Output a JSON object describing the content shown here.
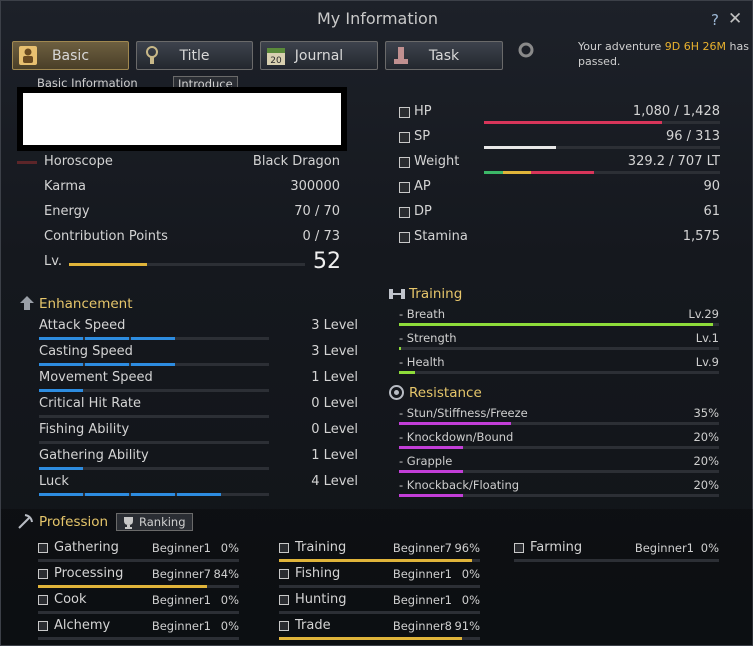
{
  "window": {
    "title": "My Information",
    "help_label": "?",
    "close_label": "✕"
  },
  "tabs": [
    {
      "label": "Basic",
      "icon": "person-icon",
      "active": true
    },
    {
      "label": "Title",
      "icon": "medal-icon",
      "active": false
    },
    {
      "label": "Journal",
      "icon": "calendar-icon",
      "calendar_number": "20",
      "active": false
    },
    {
      "label": "Task",
      "icon": "task-icon",
      "active": false
    }
  ],
  "adventure": {
    "prefix": "Your adventure ",
    "time": "9D 6H 26M",
    "suffix": " has passed."
  },
  "basic_info": {
    "section_label": "Basic Information",
    "introduce_button": "Introduce"
  },
  "stats_left": [
    {
      "label": "Horoscope",
      "value": "Black Dragon"
    },
    {
      "label": "Karma",
      "value": "300000"
    },
    {
      "label": "Energy",
      "value": "70 / 70"
    },
    {
      "label": "Contribution Points",
      "value": "0 / 73"
    }
  ],
  "level": {
    "label": "Lv.",
    "value": "52",
    "progress": 0.33
  },
  "stats_right": [
    {
      "label": "HP",
      "value": "1,080 / 1,428",
      "icon": "plus-icon",
      "bar_color": "#d8355a",
      "fill": 0.756
    },
    {
      "label": "SP",
      "value": "96 / 313",
      "icon": "spirit-icon",
      "bar_color": "#e8e8e8",
      "fill": 0.307
    },
    {
      "label": "Weight",
      "value": "329.2 / 707 LT",
      "icon": "weight-icon",
      "fill": 0.465
    },
    {
      "label": "AP",
      "value": "90",
      "icon": "sword-icon"
    },
    {
      "label": "DP",
      "value": "61",
      "icon": "shield-icon"
    },
    {
      "label": "Stamina",
      "value": "1,575",
      "icon": "stamina-icon"
    }
  ],
  "enhancement": {
    "title": "Enhancement",
    "items": [
      {
        "label": "Attack Speed",
        "value": "3 Level",
        "level": 3
      },
      {
        "label": "Casting Speed",
        "value": "3 Level",
        "level": 3
      },
      {
        "label": "Movement Speed",
        "value": "1 Level",
        "level": 1
      },
      {
        "label": "Critical Hit Rate",
        "value": "0 Level",
        "level": 0
      },
      {
        "label": "Fishing Ability",
        "value": "0 Level",
        "level": 0
      },
      {
        "label": "Gathering Ability",
        "value": "1 Level",
        "level": 1
      },
      {
        "label": "Luck",
        "value": "4 Level",
        "level": 4
      }
    ]
  },
  "training": {
    "title": "Training",
    "items": [
      {
        "label": "- Breath",
        "value": "Lv.29",
        "fill": 0.98
      },
      {
        "label": "- Strength",
        "value": "Lv.1",
        "fill": 0.0
      },
      {
        "label": "- Health",
        "value": "Lv.9",
        "fill": 0.05
      }
    ]
  },
  "resistance": {
    "title": "Resistance",
    "items": [
      {
        "label": "- Stun/Stiffness/Freeze",
        "value": "35%",
        "fill": 0.35
      },
      {
        "label": "- Knockdown/Bound",
        "value": "20%",
        "fill": 0.2
      },
      {
        "label": "- Grapple",
        "value": "20%",
        "fill": 0.2
      },
      {
        "label": "- Knockback/Floating",
        "value": "20%",
        "fill": 0.2
      }
    ]
  },
  "profession": {
    "title": "Profession",
    "ranking_button": "Ranking",
    "columns": [
      [
        {
          "label": "Gathering",
          "rank": "Beginner1",
          "pct": "0%",
          "fill": 0.0
        },
        {
          "label": "Processing",
          "rank": "Beginner7",
          "pct": "84%",
          "fill": 0.84
        },
        {
          "label": "Cook",
          "rank": "Beginner1",
          "pct": "0%",
          "fill": 0.0
        },
        {
          "label": "Alchemy",
          "rank": "Beginner1",
          "pct": "0%",
          "fill": 0.0
        }
      ],
      [
        {
          "label": "Training",
          "rank": "Beginner7",
          "pct": "96%",
          "fill": 0.96
        },
        {
          "label": "Fishing",
          "rank": "Beginner1",
          "pct": "0%",
          "fill": 0.0
        },
        {
          "label": "Hunting",
          "rank": "Beginner1",
          "pct": "0%",
          "fill": 0.0
        },
        {
          "label": "Trade",
          "rank": "Beginner8",
          "pct": "91%",
          "fill": 0.91
        }
      ],
      [
        {
          "label": "Farming",
          "rank": "Beginner1",
          "pct": "0%",
          "fill": 0.0
        }
      ]
    ]
  },
  "colors": {
    "accent_gold": "#e6c66b",
    "level_bar": "#e0b43a",
    "enhance_bar": "#2d8ce0",
    "training_bar": "#8edc3a",
    "resist_bar": "#c23ed8",
    "prof_bar": "#e0b43a"
  }
}
